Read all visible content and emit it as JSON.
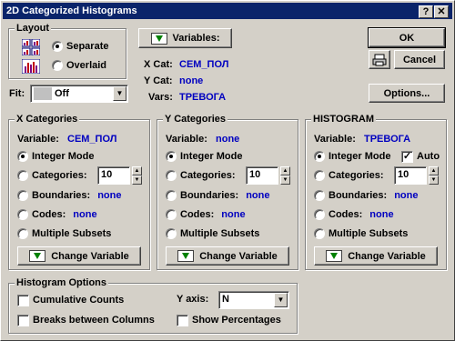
{
  "window": {
    "title": "2D Categorized Histograms",
    "help": "?",
    "close": "✕"
  },
  "layout": {
    "title": "Layout",
    "separate": "Separate",
    "overlaid": "Overlaid"
  },
  "fit": {
    "label": "Fit:",
    "value": "Off"
  },
  "variables": {
    "button": "Variables:",
    "xcat_label": "X Cat:",
    "xcat_value": "СЕМ_ПОЛ",
    "ycat_label": "Y Cat:",
    "ycat_value": "none",
    "vars_label": "Vars:",
    "vars_value": "ТРЕВОГА"
  },
  "buttons": {
    "ok": "OK",
    "cancel": "Cancel",
    "options": "Options..."
  },
  "xcat": {
    "title": "X Categories",
    "variable_label": "Variable:",
    "variable_value": "СЕМ_ПОЛ",
    "integer_mode": "Integer Mode",
    "categories": "Categories:",
    "categories_value": "10",
    "boundaries": "Boundaries:",
    "boundaries_value": "none",
    "codes": "Codes:",
    "codes_value": "none",
    "multiple": "Multiple Subsets",
    "change": "Change Variable"
  },
  "ycat": {
    "title": "Y Categories",
    "variable_label": "Variable:",
    "variable_value": "none",
    "integer_mode": "Integer Mode",
    "categories": "Categories:",
    "categories_value": "10",
    "boundaries": "Boundaries:",
    "boundaries_value": "none",
    "codes": "Codes:",
    "codes_value": "none",
    "multiple": "Multiple Subsets",
    "change": "Change Variable"
  },
  "hist": {
    "title": "HISTOGRAM",
    "variable_label": "Variable:",
    "variable_value": "ТРЕВОГА",
    "integer_mode": "Integer Mode",
    "auto": "Auto",
    "categories": "Categories:",
    "categories_value": "10",
    "boundaries": "Boundaries:",
    "boundaries_value": "none",
    "codes": "Codes:",
    "codes_value": "none",
    "multiple": "Multiple Subsets",
    "change": "Change Variable"
  },
  "hist_options": {
    "title": "Histogram Options",
    "cumulative": "Cumulative Counts",
    "breaks": "Breaks between Columns",
    "yaxis_label": "Y axis:",
    "yaxis_value": "N",
    "show_pct": "Show Percentages"
  }
}
